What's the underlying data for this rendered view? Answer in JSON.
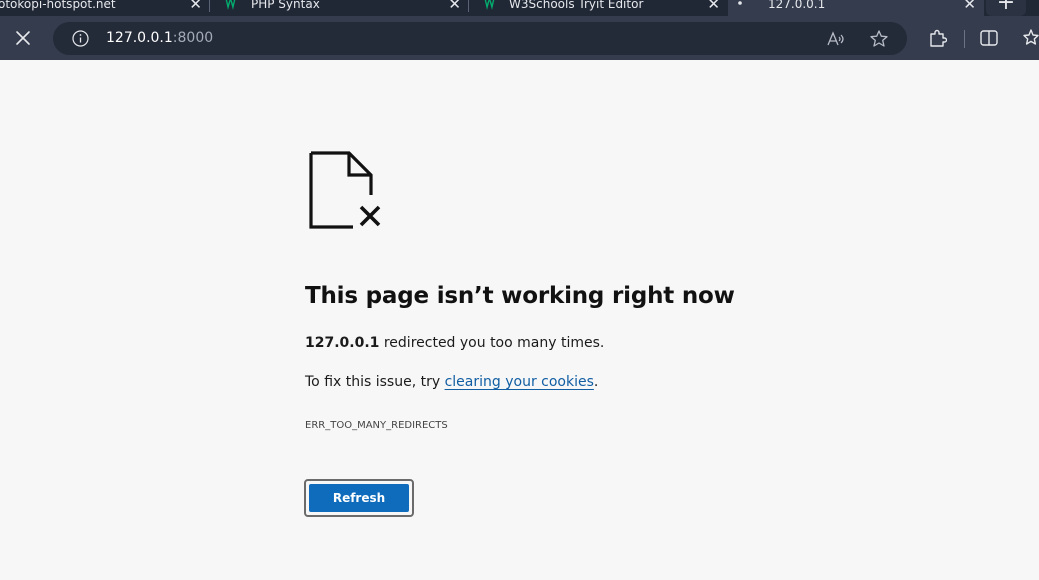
{
  "browser": {
    "tabs": [
      {
        "title": "otokopi-hotspot.net",
        "active": false,
        "favicon": "none"
      },
      {
        "title": "PHP Syntax",
        "active": false,
        "favicon": "w3schools-icon"
      },
      {
        "title": "W3Schools Tryit Editor",
        "active": false,
        "favicon": "w3schools-icon"
      },
      {
        "title": "127.0.0.1",
        "active": true,
        "favicon": "loading-dot"
      }
    ],
    "tab_close_glyph": "✕",
    "new_tab_glyph": "+",
    "address_bar": {
      "host": "127.0.0.1",
      "port": ":8000"
    },
    "colors": {
      "tabstrip": "#202735",
      "toolbar": "#343c4d",
      "omnibox": "#232a38",
      "w3schools_green": "#04aa6d"
    }
  },
  "page": {
    "heading": "This page isn’t working right now",
    "host_bold": "127.0.0.1",
    "redirect_text": " redirected you too many times.",
    "fix_prefix": "To fix this issue, try ",
    "fix_link": "clearing your cookies",
    "fix_suffix": ".",
    "error_code": "ERR_TOO_MANY_REDIRECTS",
    "refresh_label": "Refresh",
    "colors": {
      "background": "#f7f7f7",
      "link": "#115ea3",
      "button": "#0f6cbd"
    }
  }
}
